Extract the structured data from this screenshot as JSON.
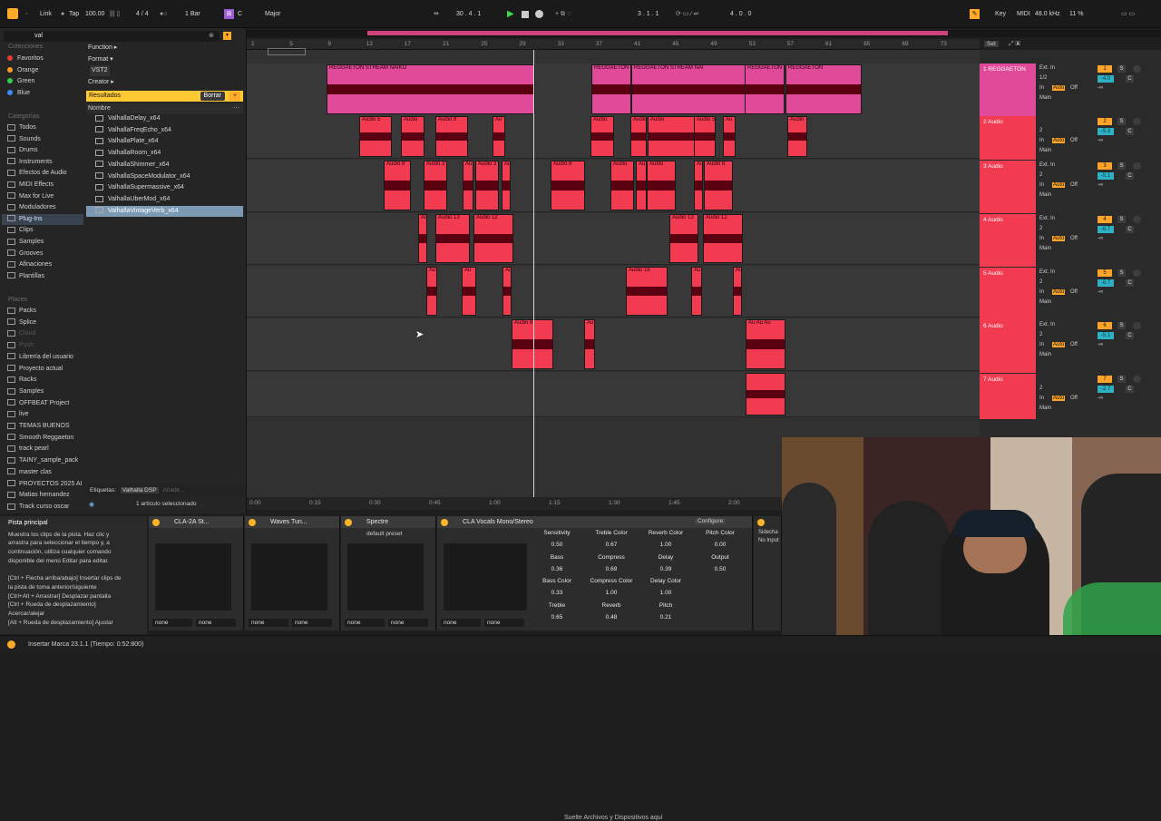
{
  "topbar": {
    "link": "Link",
    "tap": "Tap",
    "bpm": "100.00",
    "meter": "4 / 4",
    "quant": "1 Bar",
    "key_root": "C",
    "scale": "Major",
    "position": "30 .  4 .  1",
    "loop_start": "3 .  1 .  1",
    "loop_len": "4 .  0 .  0",
    "key_label": "Key",
    "midi_label": "MIDI",
    "sample_rate": "48.0 kHz",
    "cpu": "11 %"
  },
  "browser": {
    "search_value": "val",
    "collections_header": "Colecciones",
    "collections": [
      {
        "label": "Favoritos",
        "color": "#e33c3c"
      },
      {
        "label": "Orange",
        "color": "#ff9c2a"
      },
      {
        "label": "Green",
        "color": "#2fcf4a"
      },
      {
        "label": "Blue",
        "color": "#3a8cff"
      }
    ],
    "categories_header": "Categorías",
    "categories": [
      "Todos",
      "Sounds",
      "Drums",
      "Instruments",
      "Efectos de Audio",
      "MIDI Effects",
      "Max for Live",
      "Moduladores",
      "Plug-Ins",
      "Clips",
      "Samples",
      "Grooves",
      "Afinaciones",
      "Plantillas"
    ],
    "places_header": "Places",
    "places": [
      "Packs",
      "Splice",
      "Cloud",
      "Push",
      "Librería del usuario",
      "Proyecto actual",
      "Racks",
      "Samples",
      "OFFBEAT Project",
      "live",
      "TEMAS BUENOS",
      "Smooth Reggaeton",
      "track pearl",
      "TAINY_sample_pack",
      "master clas",
      "PROYECTOS 2025 AI",
      "Matias hernandez",
      "Track curso oscar"
    ],
    "filters": [
      "Function ▸",
      "Format ▾",
      "VST2",
      "Creator ▸"
    ],
    "results_label": "Resultados",
    "clear_label": "Borrar",
    "name_header": "Nombre",
    "files": [
      "ValhallaDelay_x64",
      "ValhallaFreqEcho_x64",
      "ValhallaPlate_x64",
      "ValhallaRoom_x64",
      "ValhallaShimmer_x64",
      "ValhallaSpaceModulator_x64",
      "ValhallaSupermassive_x64",
      "ValhallaUberMod_x64",
      "ValhallaVintageVerb_x64"
    ],
    "tags_label": "Etiquetas:",
    "tag_value": "Valhalla DSP",
    "tag_add": "Añadir...",
    "selection_count": "1 artículo seleccionado"
  },
  "arrangement": {
    "bars": [
      "1",
      "5",
      "9",
      "13",
      "17",
      "21",
      "25",
      "29",
      "33",
      "37",
      "41",
      "45",
      "49",
      "53",
      "57",
      "61",
      "65",
      "69",
      "73"
    ],
    "drop_hint": "Suelte Archivos y Dispositivos aquí",
    "times": [
      "0:00",
      "0:15",
      "0:30",
      "0:45",
      "1:00",
      "1:15",
      "1:30",
      "1:45",
      "2:00"
    ],
    "set_label": "Set"
  },
  "tracks": [
    {
      "name": "1 REGGAETON",
      "num": "1",
      "input": "Ext. In",
      "ch": "1/2",
      "vol": "-4.0",
      "color": "#e04a98",
      "clips": [
        {
          "label": "REGGAETON STREAM NAIKO"
        },
        {
          "label": "REGGAETON"
        },
        {
          "label": "REGGAETON STREAM NAI"
        },
        {
          "label": "REGGAETON"
        },
        {
          "label": "REGGAETON"
        }
      ]
    },
    {
      "name": "2 Audio",
      "num": "2",
      "input": "",
      "ch": "2",
      "vol": "-5.3",
      "color": "#f23a51",
      "clips": [
        {
          "label": "Audio 5"
        },
        {
          "label": "Audio"
        },
        {
          "label": "Audio 8"
        },
        {
          "label": "Au"
        },
        {
          "label": "Audio"
        },
        {
          "label": "Audio"
        },
        {
          "label": "Audio"
        },
        {
          "label": "Audio 5"
        },
        {
          "label": "Au"
        },
        {
          "label": "Audio"
        }
      ]
    },
    {
      "name": "3 Audio",
      "num": "3",
      "input": "Ext. In",
      "ch": "2",
      "vol": "-5.1",
      "color": "#f23a51",
      "clips": [
        {
          "label": "Audio 8"
        },
        {
          "label": "Audio 3"
        },
        {
          "label": "Au"
        },
        {
          "label": "Audio 3"
        },
        {
          "label": "Au"
        },
        {
          "label": "Audio 8"
        },
        {
          "label": "Audio"
        },
        {
          "label": "Au"
        },
        {
          "label": "Audio"
        },
        {
          "label": "Au"
        },
        {
          "label": "Audio 8"
        }
      ]
    },
    {
      "name": "4 Audio",
      "num": "4",
      "input": "Ext. In",
      "ch": "2",
      "vol": "-6.7",
      "color": "#f23a51",
      "clips": [
        {
          "label": "Au"
        },
        {
          "label": "Audio 13"
        },
        {
          "label": "Audio 12"
        },
        {
          "label": "Audio 13"
        },
        {
          "label": "Audio 12"
        }
      ]
    },
    {
      "name": "5 Audio",
      "num": "5",
      "input": "Ext. In",
      "ch": "2",
      "vol": "-6.7",
      "color": "#f23a51",
      "clips": [
        {
          "label": "Au"
        },
        {
          "label": "Au"
        },
        {
          "label": "Au"
        },
        {
          "label": "Audio 16"
        },
        {
          "label": "Au"
        },
        {
          "label": "Au"
        }
      ]
    },
    {
      "name": "6 Audio",
      "num": "6",
      "input": "Ext. In",
      "ch": "2",
      "vol": "-5.1",
      "color": "#f23a51",
      "clips": [
        {
          "label": "Audio 8"
        },
        {
          "label": "Au"
        },
        {
          "label": "Au Au Au"
        }
      ]
    },
    {
      "name": "7 Audio",
      "num": "7",
      "input": "",
      "ch": "2",
      "vol": "-2.7",
      "color": "#f23a51",
      "clips": [
        {
          "label": ""
        }
      ]
    }
  ],
  "track_common": {
    "in": "In",
    "auto": "Auto",
    "off": "Off",
    "main": "Main",
    "solo": "S",
    "cue": "C",
    "inf": "-∞"
  },
  "info": {
    "title": "Pista principal",
    "body": [
      "Muestra los clips de la pista. Haz clic y",
      "arrastra para seleccionar el tiempo y, a",
      "continuación, utiliza cualquier comando",
      "disponible del menú Editar para editar.",
      "",
      "[Ctrl + Flecha arriba/abajo] Insertar clips de",
      "la pista de toma anterior/siguiente",
      "[Ctrl+Alt + Arrastrar] Desplazar pantalla",
      "[Ctrl + Rueda de desplazamiento]",
      "Acercar/alejar",
      "[Alt + Rueda de desplazamiento] Ajustar"
    ]
  },
  "devices": [
    {
      "name": "CLA-2A St...",
      "preset": ""
    },
    {
      "name": "Waves Tun...",
      "preset": ""
    },
    {
      "name": "Spectre",
      "preset": "default preset"
    },
    {
      "name": "CLA Vocals Mono/Stereo",
      "preset": "",
      "configure": "Configure"
    }
  ],
  "device_select_none": "none",
  "macros": [
    {
      "label": "Sensitivity",
      "value": "0.50"
    },
    {
      "label": "Treble Color",
      "value": "0.67"
    },
    {
      "label": "Reverb Color",
      "value": "1.00"
    },
    {
      "label": "Pitch Color",
      "value": "0.00"
    },
    {
      "label": "Bass",
      "value": "0.36"
    },
    {
      "label": "Compress",
      "value": "0.69"
    },
    {
      "label": "Delay",
      "value": "0.39"
    },
    {
      "label": "Output",
      "value": "0.50"
    },
    {
      "label": "Bass Color",
      "value": "0.33"
    },
    {
      "label": "Compress Color",
      "value": "1.00"
    },
    {
      "label": "Delay Color",
      "value": "1.00"
    },
    {
      "label": "",
      "value": ""
    },
    {
      "label": "Treble",
      "value": "0.65"
    },
    {
      "label": "Reverb",
      "value": "0.48"
    },
    {
      "label": "Pitch",
      "value": "0.21"
    },
    {
      "label": "",
      "value": ""
    }
  ],
  "sidechain": {
    "label": "Sidecha",
    "input": "No Input"
  },
  "status": "Insertar Marca 23.1.1 (Tiempo: 0:52:800)"
}
